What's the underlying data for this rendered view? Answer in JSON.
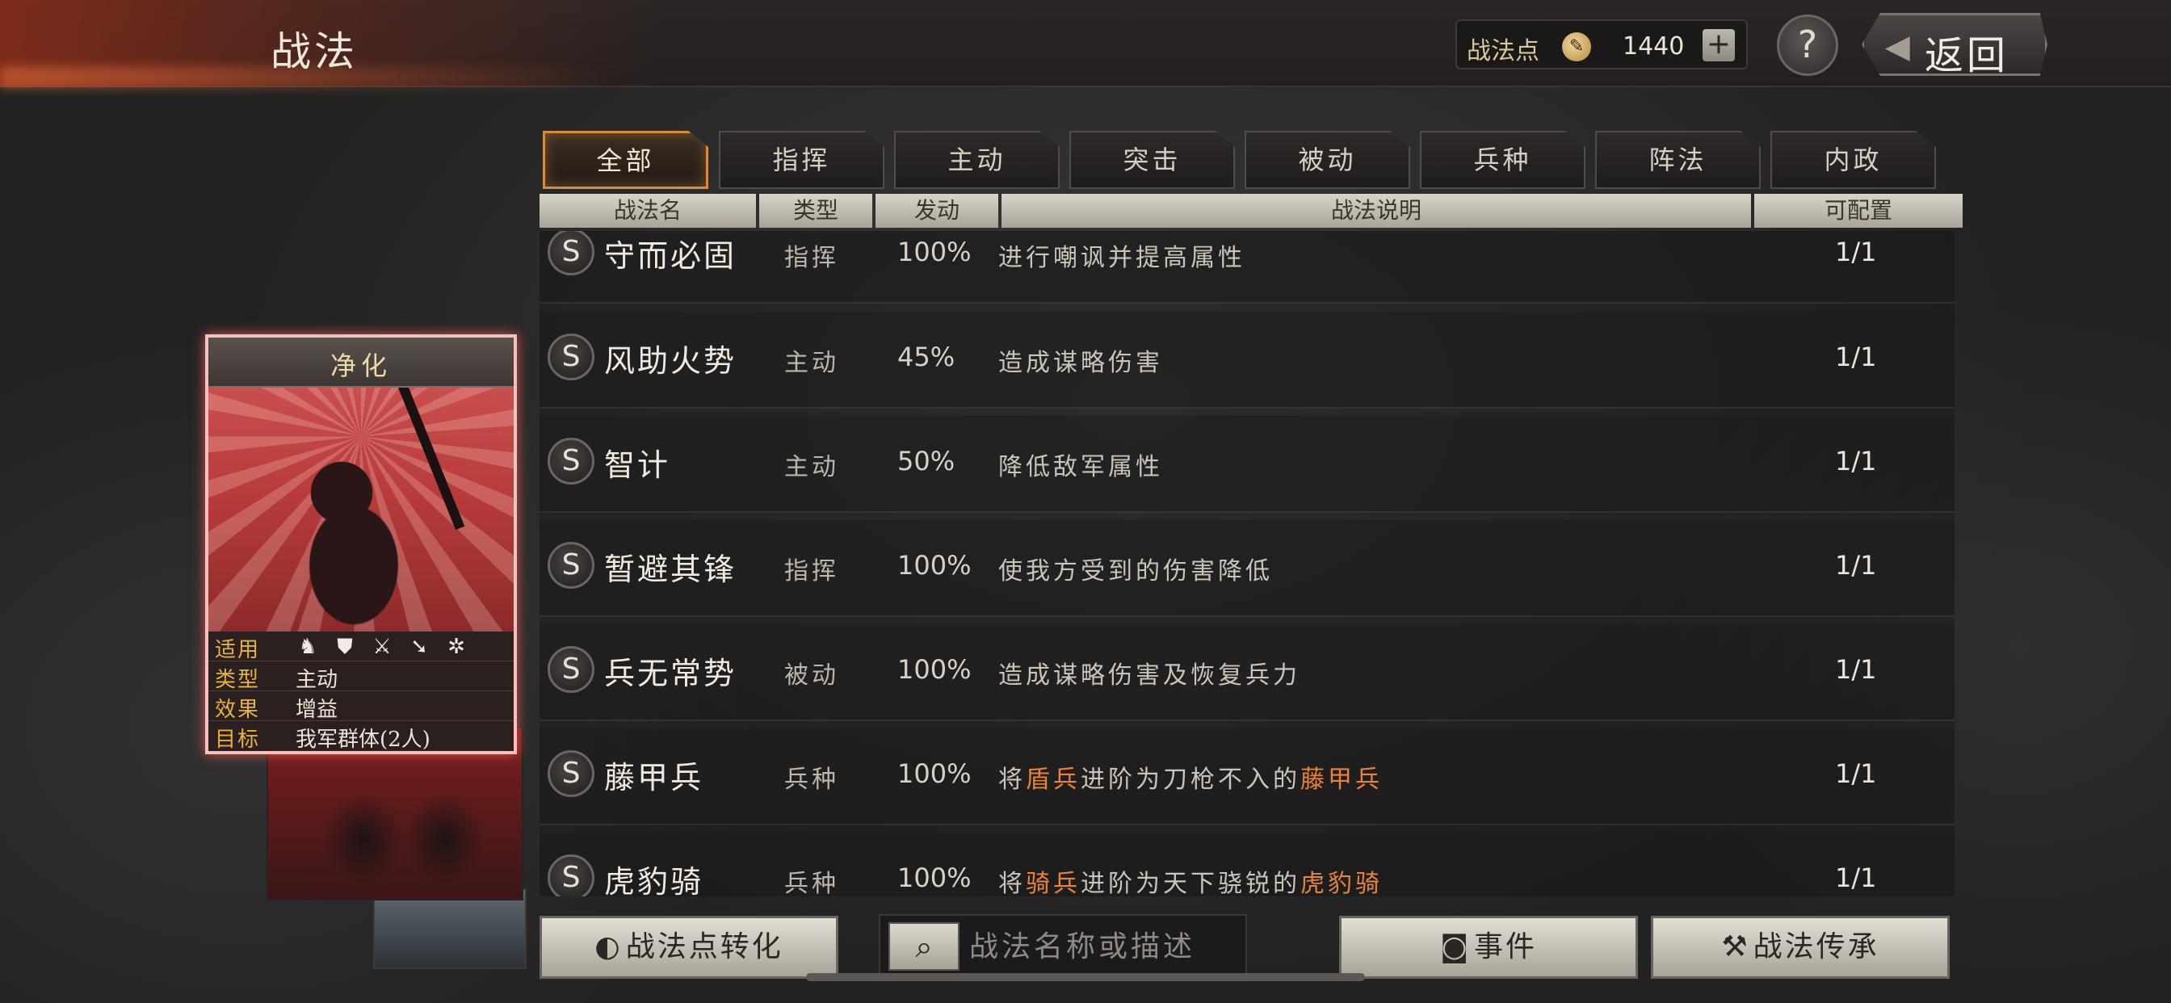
{
  "header": {
    "title": "战法",
    "points_label": "战法点",
    "points_value": "1440",
    "plus": "+",
    "help": "?",
    "back_label": "返回"
  },
  "tabs": [
    "全部",
    "指挥",
    "主动",
    "突击",
    "被动",
    "兵种",
    "阵法",
    "内政"
  ],
  "active_tab": "全部",
  "columns": [
    "战法名",
    "类型",
    "发动",
    "战法说明",
    "可配置"
  ],
  "rows": [
    {
      "name": "守而必固",
      "type": "指挥",
      "rate": "100%",
      "desc": [
        "进行嘲讽并提高属性"
      ],
      "config": "1/1"
    },
    {
      "name": "风助火势",
      "type": "主动",
      "rate": "45%",
      "desc": [
        "造成谋略伤害"
      ],
      "config": "1/1"
    },
    {
      "name": "智计",
      "type": "主动",
      "rate": "50%",
      "desc": [
        "降低敌军属性"
      ],
      "config": "1/1"
    },
    {
      "name": "暂避其锋",
      "type": "指挥",
      "rate": "100%",
      "desc": [
        "使我方受到的伤害降低"
      ],
      "config": "1/1"
    },
    {
      "name": "兵无常势",
      "type": "被动",
      "rate": "100%",
      "desc": [
        "造成谋略伤害及恢复兵力"
      ],
      "config": "1/1"
    },
    {
      "name": "藤甲兵",
      "type": "兵种",
      "rate": "100%",
      "desc": [
        "将",
        "盾兵",
        "进阶为刀枪不入的",
        "藤甲兵"
      ],
      "config": "1/1"
    },
    {
      "name": "虎豹骑",
      "type": "兵种",
      "rate": "100%",
      "desc": [
        "将",
        "骑兵",
        "进阶为天下骁锐的",
        "虎豹骑"
      ],
      "config": "1/1"
    }
  ],
  "row_icon": "S",
  "card": {
    "title": "净化",
    "applicable_label": "适用",
    "applicable_icons": [
      "cavalry-icon",
      "shield-icon",
      "bow-icon",
      "spear-icon",
      "siege-icon"
    ],
    "type_label": "类型",
    "type_value": "主动",
    "effect_label": "效果",
    "effect_value": "增益",
    "target_label": "目标",
    "target_value": "我军群体(2人)"
  },
  "footer": {
    "convert_label": "战法点转化",
    "search_placeholder": "战法名称或描述",
    "event_label": "事件",
    "inherit_label": "战法传承"
  },
  "colors": {
    "accent_orange": "#e8843a",
    "tab_active_border": "#d38d3c",
    "card_glow": "#f3c2bd",
    "label_gold": "#e9b23e"
  }
}
